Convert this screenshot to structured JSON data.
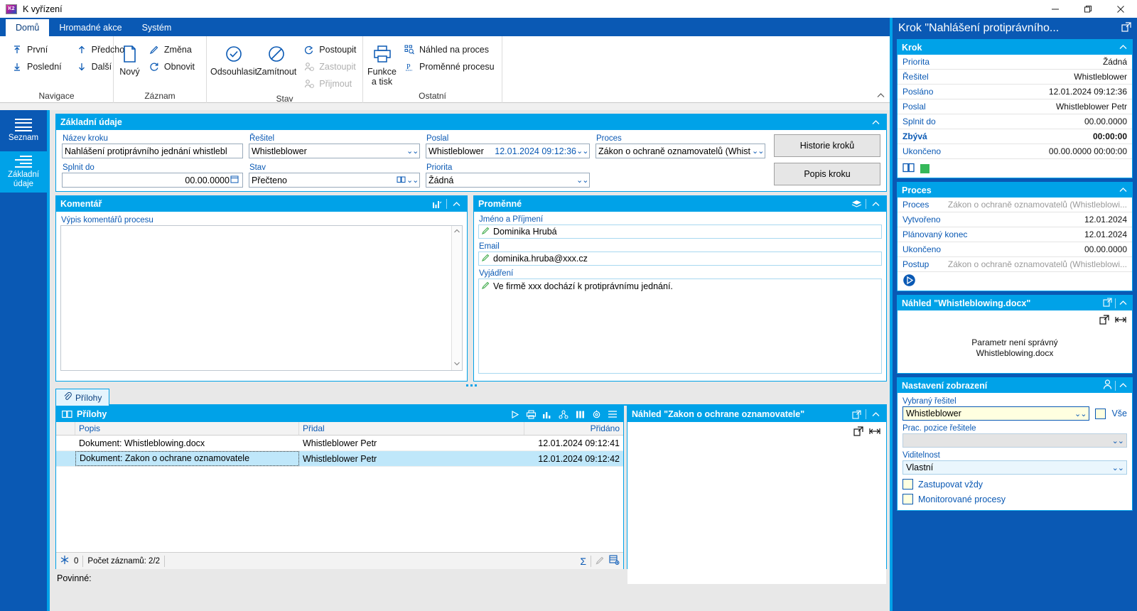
{
  "window": {
    "title": "K vyřízení",
    "minimize": "—",
    "maximize": "❐",
    "close": "✕"
  },
  "ribbon": {
    "tabs": [
      {
        "label": "Domů",
        "active": true
      },
      {
        "label": "Hromadné akce",
        "active": false
      },
      {
        "label": "Systém",
        "active": false
      }
    ],
    "groups": [
      {
        "title": "Navigace",
        "items": [
          {
            "label": "První",
            "icon": "arrow-up-first-icon"
          },
          {
            "label": "Poslední",
            "icon": "arrow-down-last-icon"
          },
          {
            "label": "Předchozí",
            "icon": "arrow-up-icon"
          },
          {
            "label": "Další",
            "icon": "arrow-down-icon"
          }
        ]
      },
      {
        "title": "Záznam",
        "big": {
          "label": "Nový",
          "icon": "new-document-icon"
        },
        "items": [
          {
            "label": "Změna",
            "icon": "pencil-icon"
          },
          {
            "label": "Obnovit",
            "icon": "refresh-icon"
          }
        ]
      },
      {
        "title": "Stav",
        "big1": {
          "label": "Odsouhlasit",
          "icon": "check-circle-icon"
        },
        "big2": {
          "label": "Zamítnout",
          "icon": "forbidden-icon"
        },
        "items": [
          {
            "label": "Postoupit",
            "icon": "forward-arrow-icon",
            "disabled": false
          },
          {
            "label": "Zastoupit",
            "icon": "person-delegate-icon",
            "disabled": true
          },
          {
            "label": "Přijmout",
            "icon": "person-accept-icon",
            "disabled": true
          }
        ]
      },
      {
        "title": "Ostatní",
        "big": {
          "label": "Funkce a tisk",
          "icon": "printer-icon"
        },
        "items": [
          {
            "label": "Náhled na proces",
            "icon": "process-preview-icon"
          },
          {
            "label": "Proměnné procesu",
            "icon": "process-variables-icon"
          }
        ]
      }
    ]
  },
  "leftnav": {
    "items": [
      {
        "label": "Seznam",
        "icon": "list-lines-icon",
        "active": false
      },
      {
        "label": "Základní\nu00fadaje",
        "label_l1": "Základní",
        "label_l2": "údaje",
        "icon": "details-list-icon",
        "active": true
      }
    ]
  },
  "basic": {
    "panel_title": "Základní údaje",
    "fields": {
      "nazev_kroku": {
        "label": "Název kroku",
        "value": "Nahlášení protiprávního jednání whistlebl"
      },
      "splnit_do": {
        "label": "Splnit do",
        "value": "00.00.0000"
      },
      "resitel": {
        "label": "Řešitel",
        "value": "Whistleblower"
      },
      "stav": {
        "label": "Stav",
        "value": "Přečteno"
      },
      "poslal": {
        "label": "Poslal",
        "value": "Whistleblower",
        "date": "12.01.2024 09:12:36"
      },
      "priorita": {
        "label": "Priorita",
        "value": "Žádná"
      },
      "proces": {
        "label": "Proces",
        "value": "Zákon o ochraně oznamovatelů (Whist"
      }
    },
    "buttons": {
      "historie": "Historie kroků",
      "popis": "Popis kroku"
    }
  },
  "komentar": {
    "panel_title": "Komentář",
    "field_label": "Výpis komentářů procesu",
    "value": ""
  },
  "promenne": {
    "panel_title": "Proměnné",
    "fields": [
      {
        "label": "Jméno a Příjmení",
        "value": "Dominika Hrubá"
      },
      {
        "label": "Email",
        "value": "dominika.hruba@xxx.cz"
      },
      {
        "label": "Vyjádření",
        "value": "Ve firmě xxx dochází k protiprávnímu jednání."
      }
    ]
  },
  "attachments": {
    "tab_label": "Přílohy",
    "panel_title": "Přílohy",
    "columns": [
      "Popis",
      "Přidal",
      "Přidáno"
    ],
    "rows": [
      {
        "popis": "Dokument: Whistleblowing.docx",
        "pridal": "Whistleblower Petr",
        "pridano": "12.01.2024 09:12:41",
        "selected": false
      },
      {
        "popis": "Dokument: Zakon o ochrane oznamovatele",
        "pridal": "Whistleblower Petr",
        "pridano": "12.01.2024 09:12:42",
        "selected": true
      }
    ],
    "footer": {
      "filter_count": "0",
      "record_count": "Počet záznamů: 2/2",
      "sum_icon": "sigma-icon",
      "edit_icon": "pencil-icon",
      "export_icon": "export-rows-icon"
    },
    "toolbar_icons": [
      "play-icon",
      "print-icon",
      "chart-icon",
      "share-icon",
      "columns-icon",
      "settings-icon",
      "menu-icon"
    ]
  },
  "preview_doc": {
    "panel_title": "Náhled \"Zakon o ochrane oznamovatele\"",
    "body": ""
  },
  "mandatory_label": "Povinné:",
  "rightpane": {
    "title": "Krok \"Nahlášení protiprávního...",
    "krok": {
      "header": "Krok",
      "rows": [
        {
          "key": "Priorita",
          "value": "Žádná",
          "bold": false,
          "muted": false
        },
        {
          "key": "Řešitel",
          "value": "Whistleblower",
          "bold": false,
          "muted": false
        },
        {
          "key": "Posláno",
          "value": "12.01.2024 09:12:36",
          "bold": false,
          "muted": false
        },
        {
          "key": "Poslal",
          "value": "Whistleblower Petr",
          "bold": false,
          "muted": false
        },
        {
          "key": "Splnit do",
          "value": "00.00.0000",
          "bold": false,
          "muted": false
        },
        {
          "key": "Zbývá",
          "value": "00:00:00",
          "bold": true,
          "muted": false
        },
        {
          "key": "Ukončeno",
          "value": "00.00.0000 00:00:00",
          "bold": false,
          "muted": false
        }
      ]
    },
    "proces": {
      "header": "Proces",
      "rows": [
        {
          "key": "Proces",
          "value": "Zákon o ochraně oznamovatelů (Whistleblowi...",
          "bold": false,
          "muted": true
        },
        {
          "key": "Vytvořeno",
          "value": "12.01.2024",
          "bold": false,
          "muted": false
        },
        {
          "key": "Plánovaný konec",
          "value": "12.01.2024",
          "bold": false,
          "muted": false
        },
        {
          "key": "Ukončeno",
          "value": "00.00.0000",
          "bold": false,
          "muted": false
        },
        {
          "key": "Postup",
          "value": "Zákon o ochraně oznamovatelů (Whistleblowi...",
          "bold": false,
          "muted": true
        }
      ]
    },
    "nahled": {
      "header": "Náhled \"Whistleblowing.docx\"",
      "message_line1": "Parametr není správný",
      "message_line2": "Whistleblowing.docx"
    },
    "settings": {
      "header": "Nastavení zobrazení",
      "resitel": {
        "label": "Vybraný řešitel",
        "value": "Whistleblower"
      },
      "vse": {
        "label": "Vše",
        "checked": false
      },
      "pozice": {
        "label": "Prac. pozice řešitele",
        "value": ""
      },
      "viditelnost": {
        "label": "Viditelnost",
        "value": "Vlastní"
      },
      "zastupovat": {
        "label": "Zastupovat vždy",
        "checked": false
      },
      "monitorovane": {
        "label": "Monitorované procesy",
        "checked": false
      }
    }
  },
  "colors": {
    "accent": "#00a2e8",
    "ribbon": "#0a59b4",
    "selection": "#bfe7fa",
    "green": "#35b85a"
  }
}
